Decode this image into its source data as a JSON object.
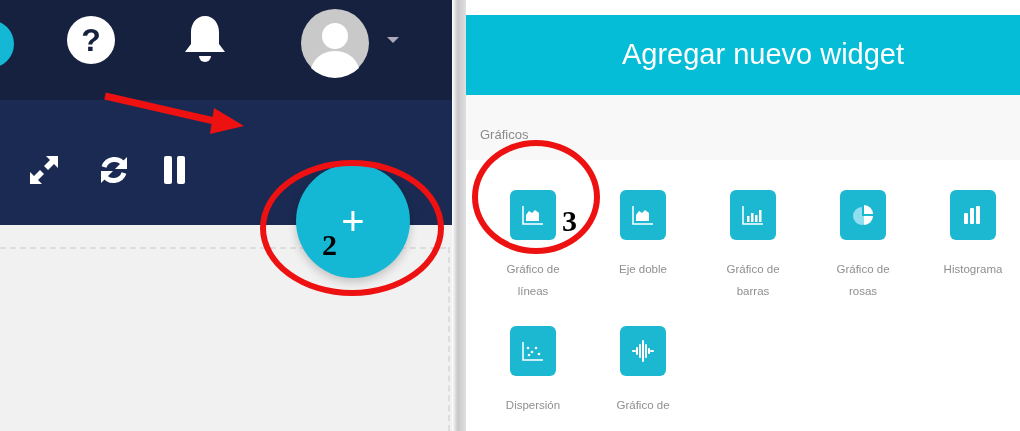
{
  "dashboard": {
    "help_button": "?",
    "add_button": "+"
  },
  "dialog": {
    "title": "Agregar nuevo widget",
    "section": "Gráficos",
    "widgets": [
      {
        "label": "Gráfico de líneas",
        "kind": "line"
      },
      {
        "label": "Eje doble",
        "kind": "dual_axis"
      },
      {
        "label": "Gráfico de barras",
        "kind": "bar"
      },
      {
        "label": "Gráfico de rosas",
        "kind": "rose"
      },
      {
        "label": "Histograma",
        "kind": "histogram"
      },
      {
        "label": "Dispersión",
        "kind": "scatter"
      },
      {
        "label": "Gráfico de",
        "kind": "frequency"
      }
    ]
  },
  "annotations": [
    {
      "label": "2"
    },
    {
      "label": "3"
    }
  ]
}
